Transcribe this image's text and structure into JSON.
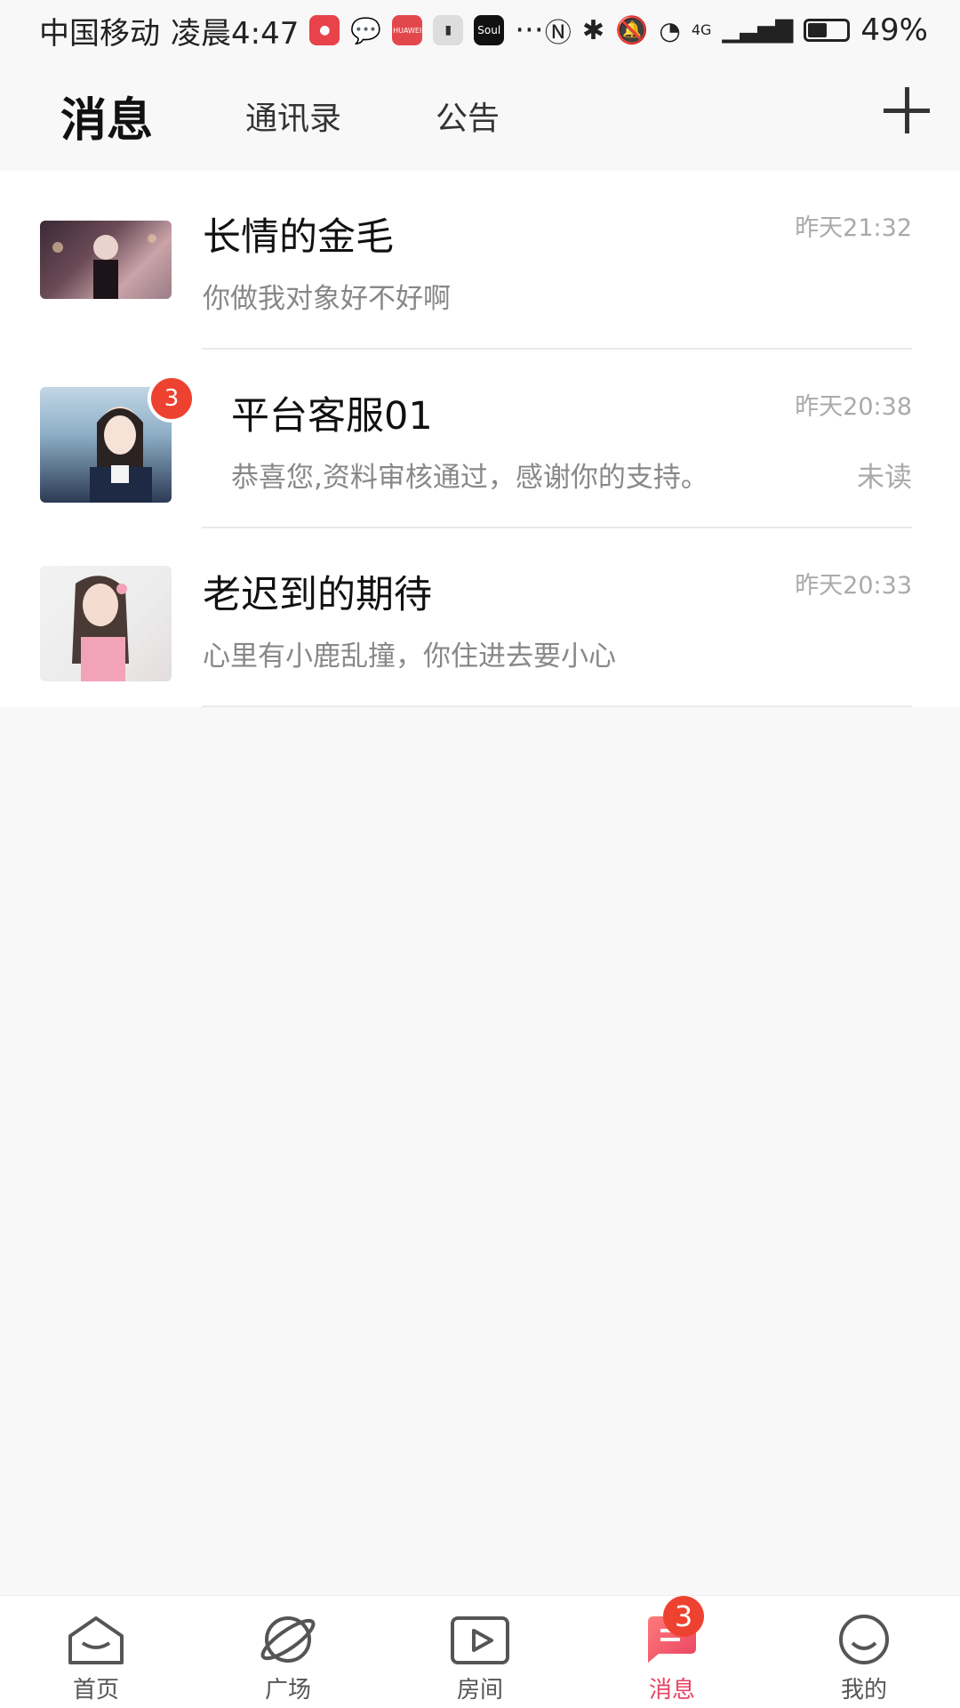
{
  "status_bar": {
    "carrier": "中国移动",
    "time": "凌晨4:47",
    "battery_percent": "49%",
    "battery_level": 0.49,
    "soul_label": "Soul",
    "huawei_label": "HUAWEI",
    "more": "···",
    "network": "4G"
  },
  "header": {
    "tabs": [
      {
        "label": "消息",
        "active": true
      },
      {
        "label": "通讯录",
        "active": false
      },
      {
        "label": "公告",
        "active": false
      }
    ]
  },
  "conversations": [
    {
      "name": "长情的金毛",
      "preview": "你做我对象好不好啊",
      "time": "昨天21:32",
      "unread_count": null,
      "unread_label": null
    },
    {
      "name": "平台客服01",
      "preview": "恭喜您,资料审核通过，感谢你的支持。",
      "time": "昨天20:38",
      "unread_count": "3",
      "unread_label": "未读"
    },
    {
      "name": "老迟到的期待",
      "preview": "心里有小鹿乱撞，你住进去要小心",
      "time": "昨天20:33",
      "unread_count": null,
      "unread_label": null
    }
  ],
  "tabbar": {
    "items": [
      {
        "label": "首页",
        "icon": "home-icon",
        "active": false
      },
      {
        "label": "广场",
        "icon": "planet-icon",
        "active": false
      },
      {
        "label": "房间",
        "icon": "play-icon",
        "active": false
      },
      {
        "label": "消息",
        "icon": "message-icon",
        "active": true,
        "badge": "3"
      },
      {
        "label": "我的",
        "icon": "smile-icon",
        "active": false
      }
    ]
  },
  "colors": {
    "accent": "#e84363",
    "badge": "#ee4230",
    "background": "#f8f8f8"
  }
}
